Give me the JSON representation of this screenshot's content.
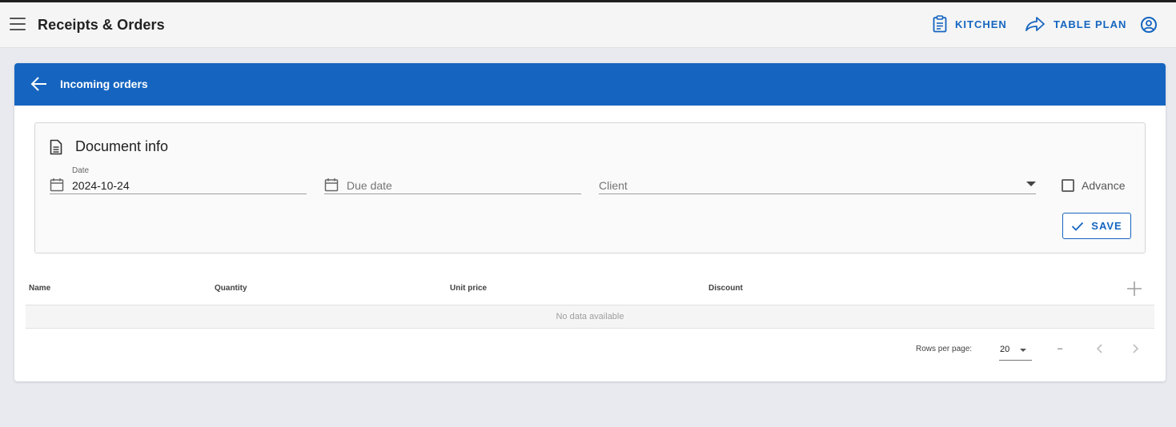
{
  "appbar": {
    "title": "Receipts & Orders",
    "kitchen_label": "KITCHEN",
    "table_plan_label": "TABLE PLAN"
  },
  "card": {
    "title": "Incoming orders"
  },
  "document_info": {
    "title": "Document info",
    "date_label": "Date",
    "date_value": "2024-10-24",
    "due_date_placeholder": "Due date",
    "client_placeholder": "Client",
    "advance_label": "Advance",
    "save_label": "SAVE"
  },
  "table": {
    "columns": [
      "Name",
      "Quantity",
      "Unit price",
      "Discount"
    ],
    "empty_text": "No data available"
  },
  "pagination": {
    "rows_per_page_label": "Rows per page:",
    "rows_per_page_value": "20",
    "range_text": "–"
  },
  "colors": {
    "primary": "#1565c0",
    "appbar_bg": "#f5f5f5",
    "page_bg": "#e8eaf0"
  }
}
